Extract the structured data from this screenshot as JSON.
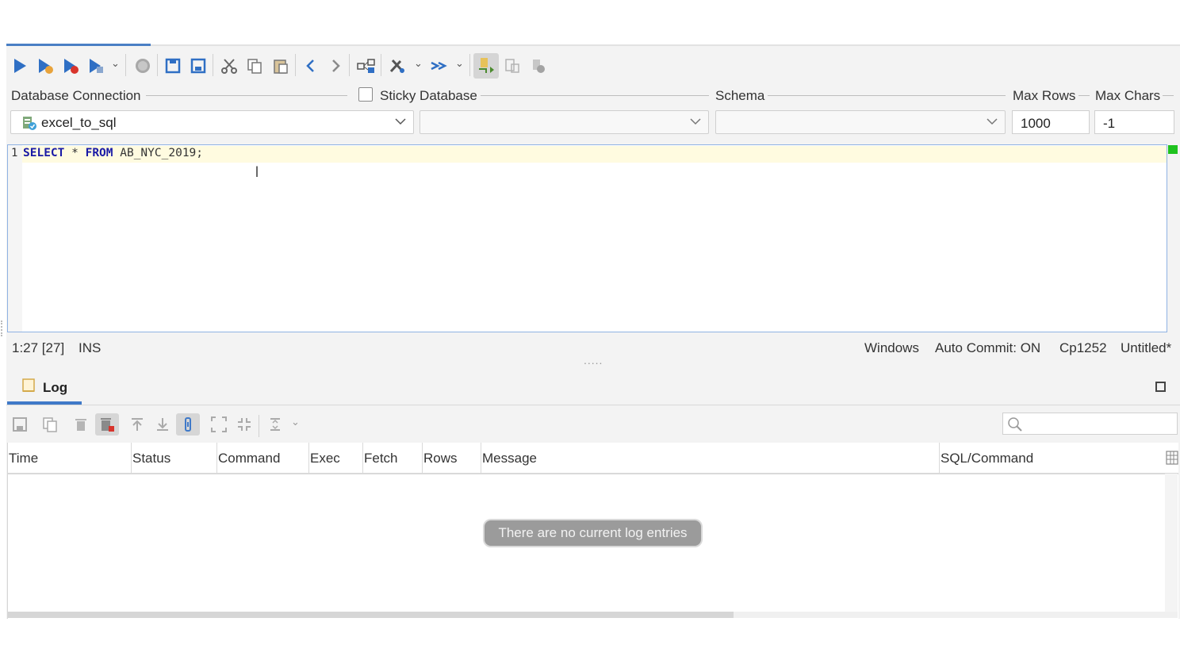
{
  "toolbar": {
    "icons": [
      "execute-icon",
      "execute-current-icon",
      "execute-stop-icon",
      "execute-explain-icon",
      "stop-icon",
      "save-icon",
      "save-as-icon",
      "cut-icon",
      "copy-icon",
      "paste-icon",
      "back-icon",
      "forward-icon",
      "query-builder-icon",
      "tools-icon",
      "format-icon",
      "connect-icon",
      "disconnect-icon",
      "settings-icon"
    ]
  },
  "connection_bar": {
    "database_connection_label": "Database Connection",
    "sticky_database_label": "Sticky Database",
    "schema_label": "Schema",
    "max_rows_label": "Max Rows",
    "max_chars_label": "Max Chars",
    "connection_value": "excel_to_sql",
    "database_value": "",
    "schema_value": "",
    "max_rows_value": "1000",
    "max_chars_value": "-1"
  },
  "editor": {
    "line_number": "1",
    "sql_keyword_select": "SELECT",
    "sql_star": " * ",
    "sql_keyword_from": "FROM",
    "sql_table": " AB_NYC_2019;"
  },
  "status_bar": {
    "position": "1:27 [27]",
    "mode": "INS",
    "line_endings": "Windows",
    "auto_commit": "Auto Commit: ON",
    "encoding": "Cp1252",
    "file_name": "Untitled*",
    "splitter": "....."
  },
  "log_panel": {
    "tab_label": "Log",
    "columns": [
      "Time",
      "Status",
      "Command",
      "Exec",
      "Fetch",
      "Rows",
      "Message",
      "SQL/Command"
    ],
    "empty_message": "There are no current log entries",
    "search_placeholder": ""
  },
  "colors": {
    "accent": "#3f79c8",
    "keyword": "#1a1aa6",
    "editor_border": "#8fb2e3",
    "status_ok": "#1ec21e"
  }
}
